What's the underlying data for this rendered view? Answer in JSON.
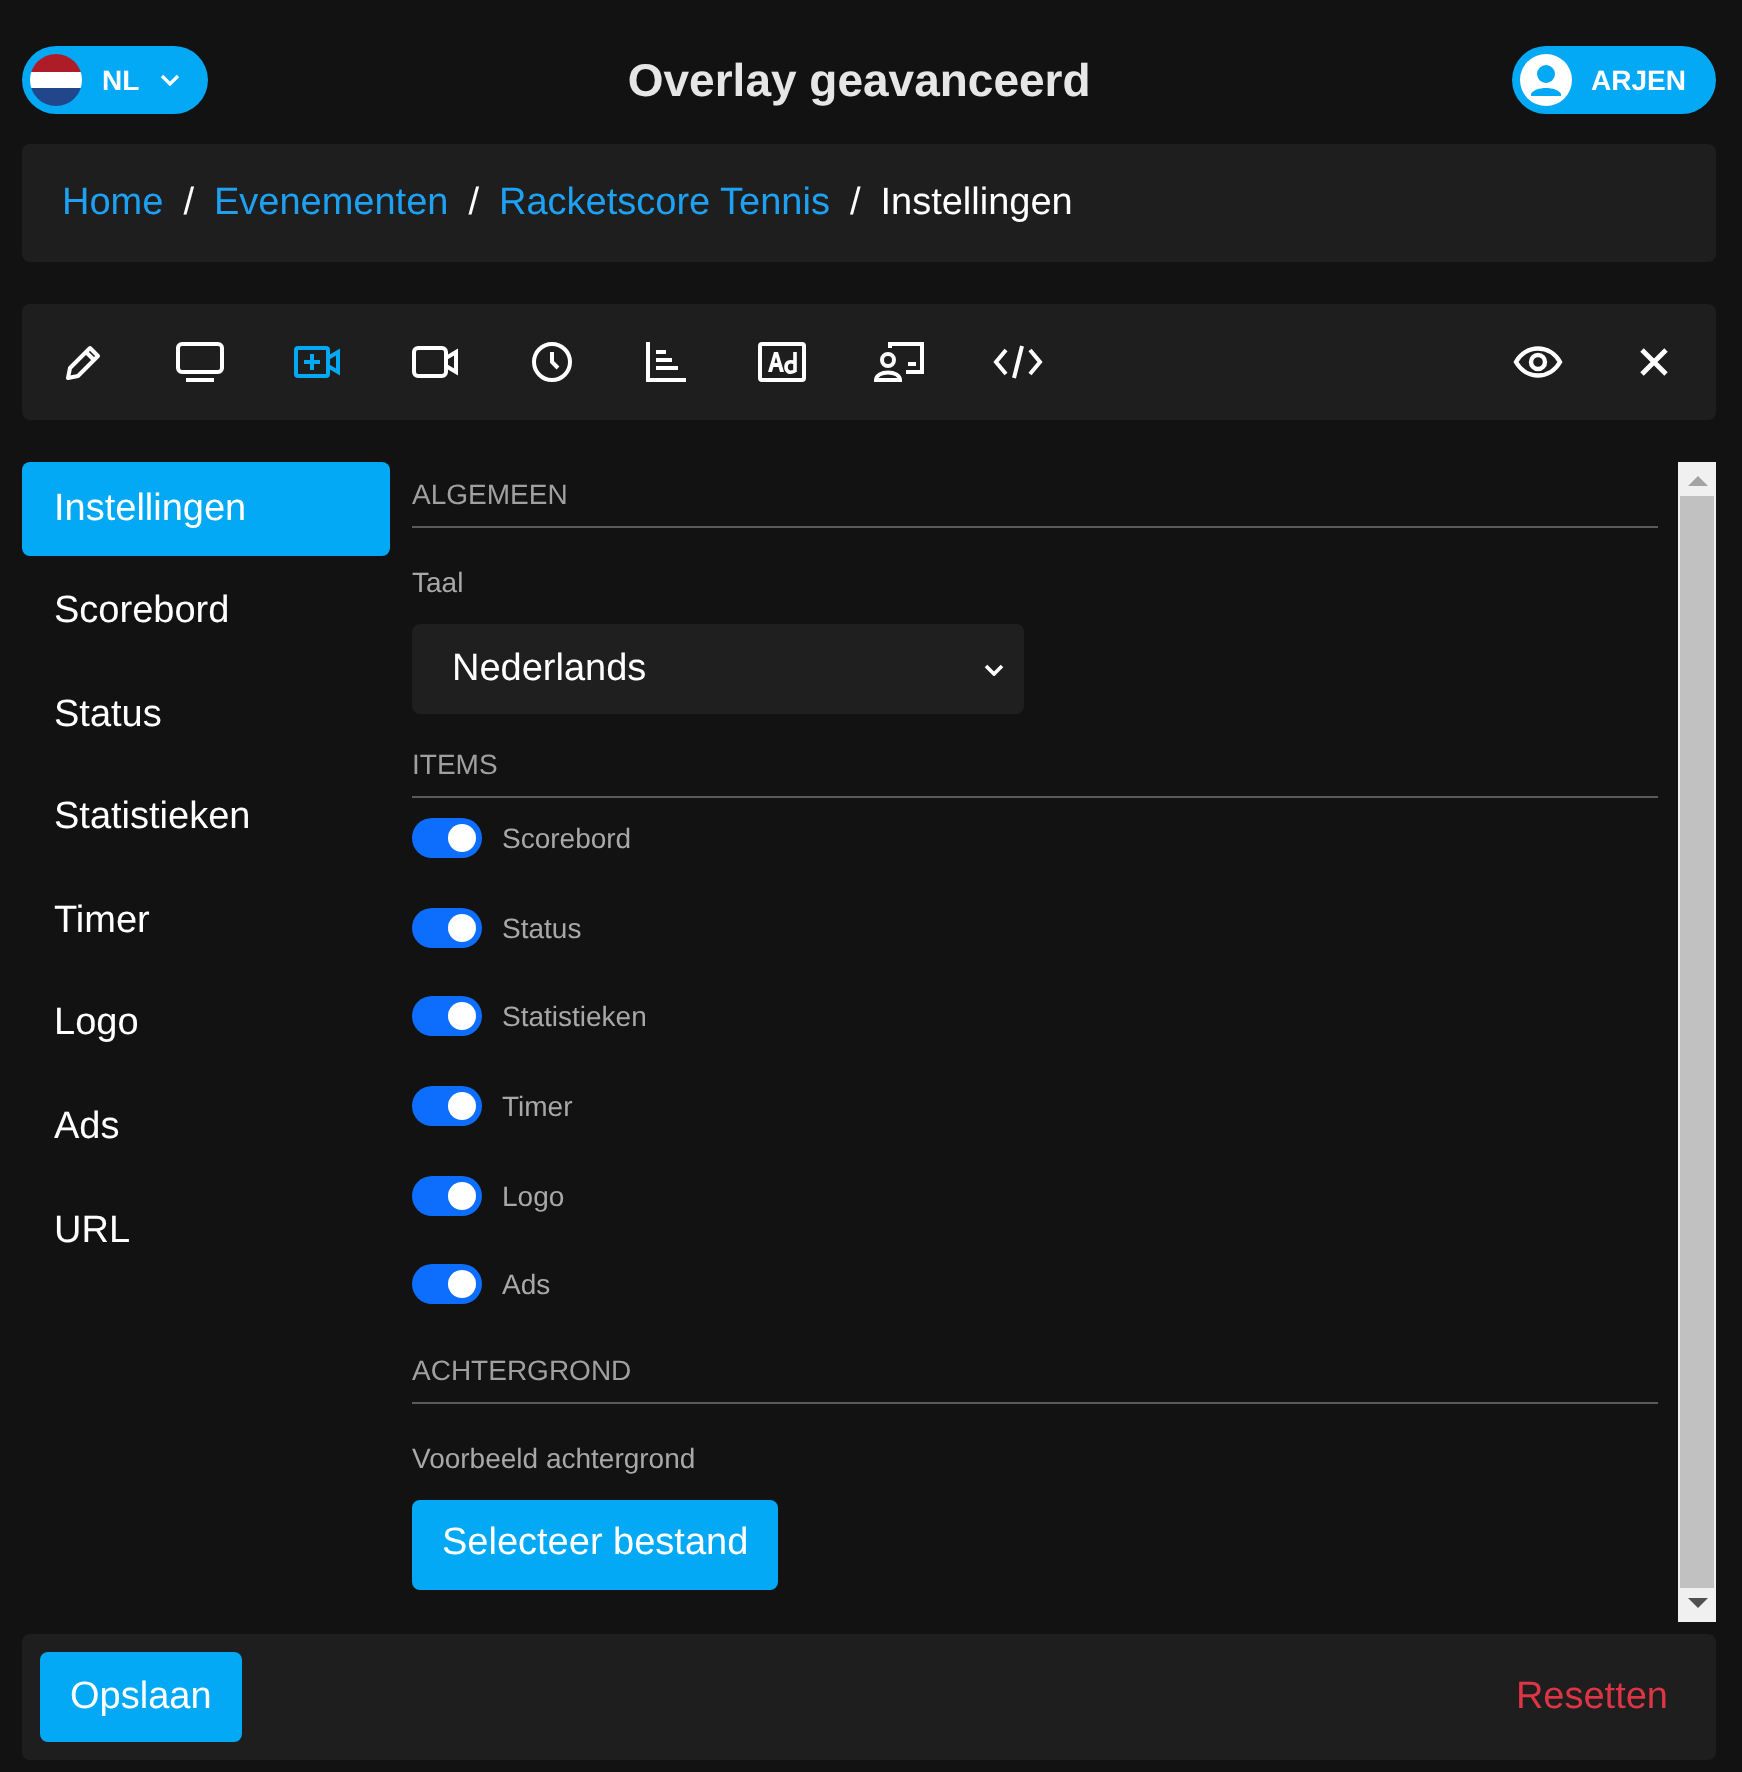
{
  "header": {
    "language": "NL",
    "title": "Overlay geavanceerd",
    "user": "ARJEN"
  },
  "breadcrumb": [
    {
      "label": "Home",
      "link": true
    },
    {
      "separator": "/",
      "label": "Evenementen",
      "link": true
    },
    {
      "separator": "/",
      "label": "Racketscore Tennis",
      "link": true
    },
    {
      "separator": "/",
      "label": "Instellingen",
      "link": false
    }
  ],
  "toolbar": [
    {
      "kind": "pencil",
      "selected": false
    },
    {
      "kind": "monitor",
      "selected": false
    },
    {
      "kind": "video-plus",
      "selected": true
    },
    {
      "kind": "video",
      "selected": false
    },
    {
      "kind": "clock",
      "selected": false
    },
    {
      "kind": "chart",
      "selected": false
    },
    {
      "kind": "ad",
      "selected": false
    },
    {
      "kind": "presenter",
      "selected": false
    },
    {
      "kind": "code",
      "selected": false
    }
  ],
  "toolbar_right": [
    {
      "kind": "eye"
    },
    {
      "kind": "close"
    }
  ],
  "sidebar": [
    {
      "label": "Instellingen",
      "selected": true
    },
    {
      "label": "Scorebord",
      "selected": false
    },
    {
      "label": "Status",
      "selected": false
    },
    {
      "label": "Statistieken",
      "selected": false
    },
    {
      "label": "Timer",
      "selected": false
    },
    {
      "label": "Logo",
      "selected": false
    },
    {
      "label": "Ads",
      "selected": false
    },
    {
      "label": "URL",
      "selected": false
    }
  ],
  "general": {
    "heading": "ALGEMEEN",
    "language_label": "Taal",
    "language_value": "Nederlands"
  },
  "items": {
    "heading": "ITEMS",
    "toggles": [
      {
        "label": "Scorebord",
        "on": true
      },
      {
        "label": "Status",
        "on": true
      },
      {
        "label": "Statistieken",
        "on": true
      },
      {
        "label": "Timer",
        "on": true
      },
      {
        "label": "Logo",
        "on": true
      },
      {
        "label": "Ads",
        "on": true
      }
    ]
  },
  "background": {
    "heading": "ACHTERGROND",
    "label": "Voorbeeld achtergrond",
    "button": "Selecteer bestand"
  },
  "footer": {
    "save": "Opslaan",
    "reset": "Resetten"
  }
}
